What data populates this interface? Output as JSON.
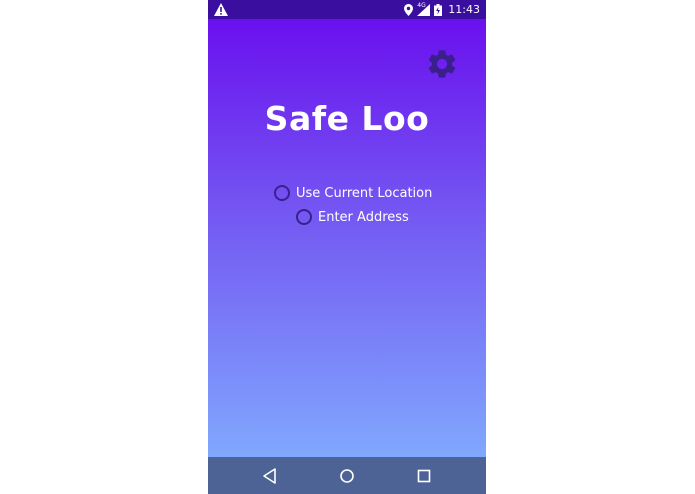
{
  "status_bar": {
    "network": "4G",
    "time": "11:43"
  },
  "app": {
    "title": "Safe Loo",
    "settings_icon": "gear-icon",
    "location_options": [
      {
        "label": "Use Current Location",
        "selected": false
      },
      {
        "label": "Enter Address",
        "selected": false
      }
    ]
  },
  "colors": {
    "status_bar": "#3a0fa0",
    "gradient_top": "#6a10ee",
    "gradient_bottom": "#80a8fe",
    "gear": "#3b1f8c",
    "radio": "#3b1f8c",
    "nav_bar": "#4d6396"
  },
  "nav_bar": {
    "icons": [
      "back-icon",
      "home-icon",
      "recent-apps-icon"
    ]
  }
}
